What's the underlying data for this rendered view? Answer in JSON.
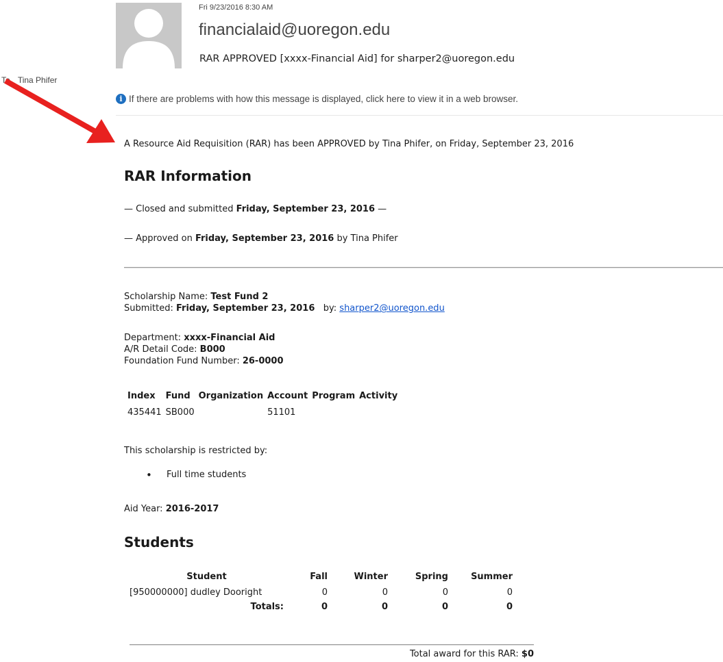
{
  "email": {
    "date": "Fri 9/23/2016 8:30 AM",
    "sender": "financialaid@uoregon.edu",
    "subject": "RAR APPROVED [xxxx-Financial Aid] for sharper2@uoregon.edu",
    "to_label": "To",
    "to_name": "Tina Phifer",
    "info_message": "If there are problems with how this message is displayed, click here to view it in a web browser.",
    "avatar_icon": "person-placeholder-icon",
    "info_icon": "info-icon"
  },
  "annotation": {
    "arrow_color": "#e8211f"
  },
  "message": {
    "intro": "A Resource Aid Requisition (RAR) has been APPROVED by Tina Phifer, on Friday, September 23, 2016",
    "rar_heading": "RAR Information",
    "closed_prefix": "— Closed and submitted ",
    "closed_date": "Friday, September 23, 2016",
    "closed_suffix": " —",
    "approved_prefix": "— Approved on ",
    "approved_date": "Friday, September 23, 2016",
    "approved_suffix": " by Tina Phifer",
    "scholarship_label": "Scholarship Name: ",
    "scholarship_value": "Test Fund 2",
    "submitted_label": "Submitted: ",
    "submitted_value": "Friday, September 23, 2016",
    "submitted_by": "   by: ",
    "submitted_email": "sharper2@uoregon.edu",
    "department_label": "Department: ",
    "department_value": "xxxx-Financial Aid",
    "ar_label": "A/R Detail Code: ",
    "ar_value": "B000",
    "foundation_label": "Foundation Fund Number: ",
    "foundation_value": "26-0000",
    "restricted_intro": "This scholarship is restricted by:",
    "restrictions": [
      "Full time students"
    ],
    "aid_year_label": "Aid Year: ",
    "aid_year_value": "2016-2017",
    "students_heading": "Students",
    "total_award_label": "Total award for this RAR: ",
    "total_award_value": "$0"
  },
  "fund_table": {
    "headers": [
      "Index",
      "Fund",
      "Organization",
      "Account",
      "Program",
      "Activity"
    ],
    "rows": [
      [
        "435441",
        "SB000",
        "",
        "51101",
        "",
        ""
      ]
    ]
  },
  "students_table": {
    "headers": [
      "Student",
      "Fall",
      "Winter",
      "Spring",
      "Summer"
    ],
    "rows": [
      [
        "[950000000] dudley Dooright",
        "0",
        "0",
        "0",
        "0"
      ]
    ],
    "totals": [
      "Totals:",
      "0",
      "0",
      "0",
      "0"
    ]
  }
}
